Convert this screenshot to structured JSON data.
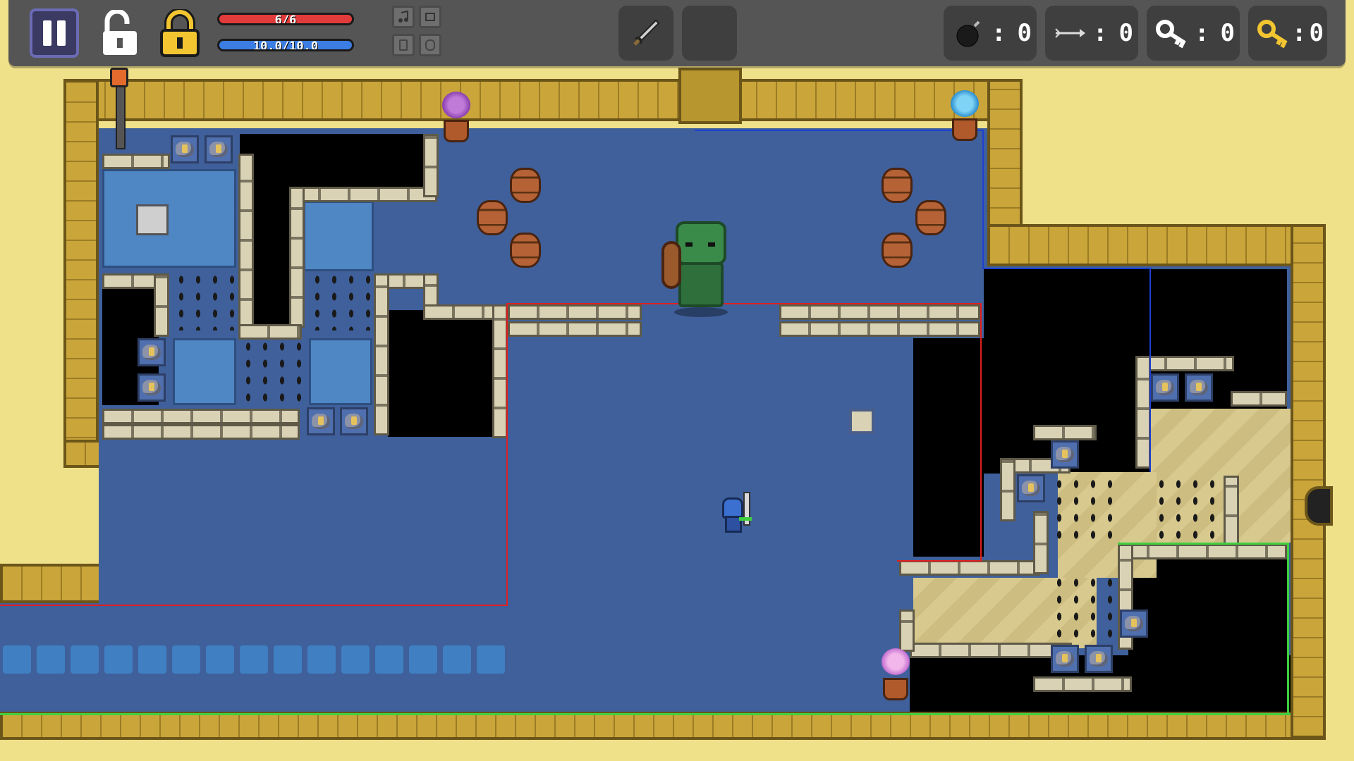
{
  "hud": {
    "health": {
      "text": "6/6",
      "fraction": 1.0,
      "color": "#e23b3b"
    },
    "mana": {
      "text": "10.0/10.0",
      "fraction": 1.0,
      "color": "#3b7de2"
    },
    "pause_icon": "pause-icon",
    "lock_open_icon": "unlocked-padlock-icon",
    "lock_closed_icon": "locked-padlock-icon",
    "mini_slots": [
      "music-note-icon",
      "scroll-icon",
      "jar-icon",
      "potion-icon"
    ],
    "weapon_slots": [
      {
        "icon": "sword-icon"
      },
      {
        "icon": "empty"
      }
    ],
    "counters": [
      {
        "icon": "bomb-icon",
        "colon": ":",
        "value": "0"
      },
      {
        "icon": "arrow-icon",
        "colon": ":",
        "value": "0"
      },
      {
        "icon": "silver-key-icon",
        "colon": ":",
        "value": "0"
      },
      {
        "icon": "gold-key-icon",
        "colon": ":",
        "value": "0"
      }
    ]
  },
  "colors": {
    "background": "#efe08a",
    "hud": "#555555",
    "wall": "#c9a53a",
    "floor": "#3f609b",
    "outline_red": "#e02020",
    "outline_blue": "#1f3fd0",
    "outline_green": "#3fd03f"
  },
  "map": {
    "player": "knight-player",
    "boss": "green-ogre-boss"
  }
}
